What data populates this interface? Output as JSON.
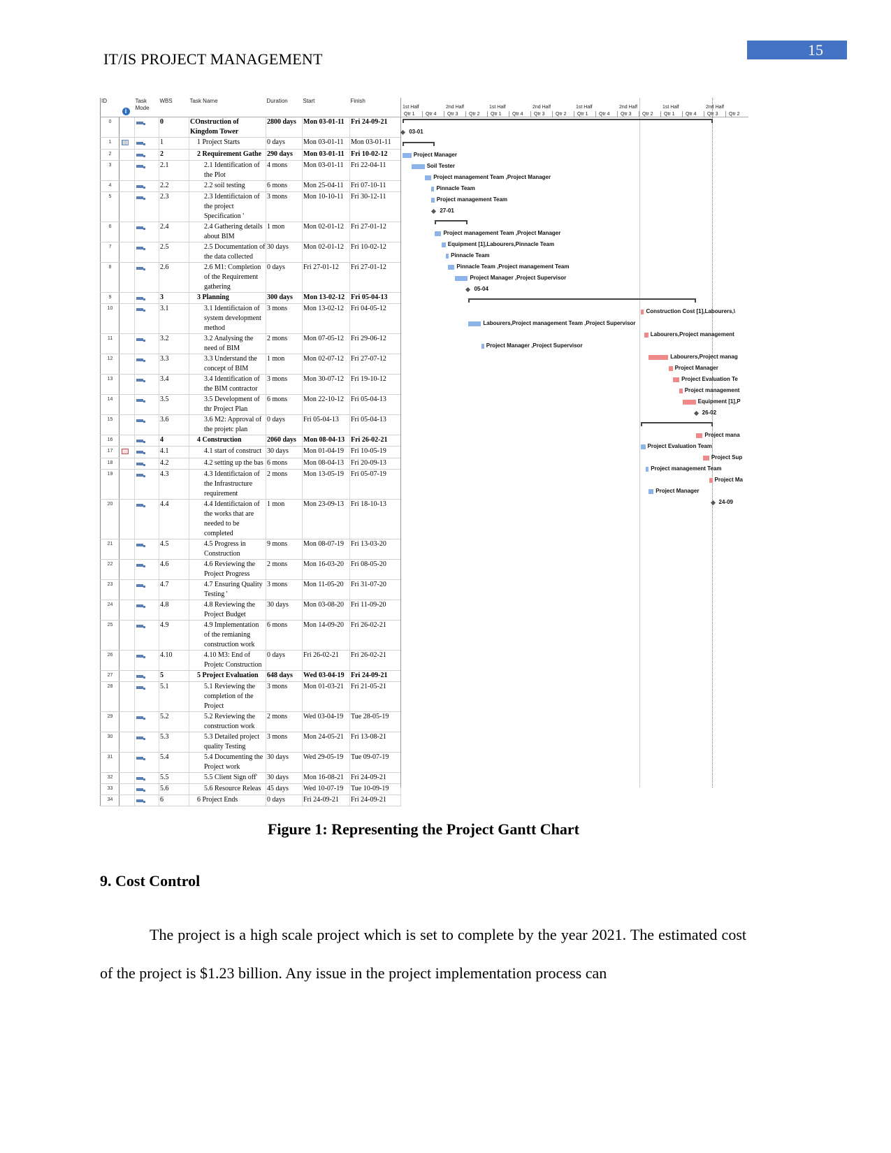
{
  "header": {
    "running_title": "IT/IS PROJECT MANAGEMENT",
    "page_number": "15",
    "page_number_bg": "#4472c4"
  },
  "gantt": {
    "columns": {
      "id": "ID",
      "task_mode": "Task Mode",
      "wbs": "WBS",
      "task_name": "Task Name",
      "duration": "Duration",
      "start": "Start",
      "finish": "Finish"
    },
    "timescale": {
      "top": [
        "1st Half",
        "2nd Half",
        "1st Half",
        "2nd Half",
        "1st Half",
        "2nd Half",
        "1st Half",
        "2nd Half"
      ],
      "bottom": [
        "Qtr 1",
        "Qtr 4",
        "Qtr 3",
        "Qtr 2",
        "Qtr 1",
        "Qtr 4",
        "Qtr 3",
        "Qtr 2",
        "Qtr 1",
        "Qtr 4",
        "Qtr 3",
        "Qtr 2",
        "Qtr 1",
        "Qtr 4",
        "Qtr 3",
        "Qtr 2"
      ]
    },
    "colors": {
      "normal_bar": "#8db4e8",
      "critical_bar": "#f08a8a",
      "summary": "#444444",
      "milestone": "#555555"
    },
    "tasks": [
      {
        "id": "0",
        "wbs": "0",
        "name": "COnstruction of Kingdom Tower",
        "duration": "2800 days",
        "start": "Mon 03-01-11",
        "finish": "Fri 24-09-21",
        "summary": true,
        "resources": ""
      },
      {
        "id": "1",
        "wbs": "1",
        "name": "1 Project Starts",
        "duration": "0 days",
        "start": "Mon 03-01-11",
        "finish": "Mon 03-01-11",
        "milestone": true,
        "resources": "03-01",
        "indicator": "calendar"
      },
      {
        "id": "2",
        "wbs": "2",
        "name": "2 Requirement Gathe",
        "duration": "290 days",
        "start": "Mon 03-01-11",
        "finish": "Fri 10-02-12",
        "summary": true,
        "resources": ""
      },
      {
        "id": "3",
        "wbs": "2.1",
        "name": "2.1 Identification of the Plot",
        "duration": "4 mons",
        "start": "Mon 03-01-11",
        "finish": "Fri 22-04-11",
        "resources": "Project Manager"
      },
      {
        "id": "4",
        "wbs": "2.2",
        "name": "2.2 soil testing",
        "duration": "6 mons",
        "start": "Mon 25-04-11",
        "finish": "Fri 07-10-11",
        "resources": "Soil Tester"
      },
      {
        "id": "5",
        "wbs": "2.3",
        "name": "2.3 Identifictaion of the project Specification '",
        "duration": "3 mons",
        "start": "Mon 10-10-11",
        "finish": "Fri 30-12-11",
        "resources": "Project management Team ,Project Manager"
      },
      {
        "id": "6",
        "wbs": "2.4",
        "name": "2.4 Gathering details about BIM",
        "duration": "1 mon",
        "start": "Mon 02-01-12",
        "finish": "Fri 27-01-12",
        "resources": "Pinnacle Team"
      },
      {
        "id": "7",
        "wbs": "2.5",
        "name": "2.5 Documentation of the data collected",
        "duration": "30 days",
        "start": "Mon 02-01-12",
        "finish": "Fri 10-02-12",
        "resources": "Project management Team"
      },
      {
        "id": "8",
        "wbs": "2.6",
        "name": "2.6 M1: Completion of the Requirement gathering",
        "duration": "0 days",
        "start": "Fri 27-01-12",
        "finish": "Fri 27-01-12",
        "milestone": true,
        "resources": "27-01"
      },
      {
        "id": "9",
        "wbs": "3",
        "name": "3 Planning",
        "duration": "300 days",
        "start": "Mon 13-02-12",
        "finish": "Fri 05-04-13",
        "summary": true,
        "resources": ""
      },
      {
        "id": "10",
        "wbs": "3.1",
        "name": "3.1 Identifictaion of system development method",
        "duration": "3 mons",
        "start": "Mon 13-02-12",
        "finish": "Fri 04-05-12",
        "resources": "Project management Team ,Project Manager"
      },
      {
        "id": "11",
        "wbs": "3.2",
        "name": "3.2 Analysing the need of BIM",
        "duration": "2 mons",
        "start": "Mon 07-05-12",
        "finish": "Fri 29-06-12",
        "resources": "Equipment [1],Labourers,Pinnacle Team"
      },
      {
        "id": "12",
        "wbs": "3.3",
        "name": "3.3 Understand the concept of BIM",
        "duration": "1 mon",
        "start": "Mon 02-07-12",
        "finish": "Fri 27-07-12",
        "resources": "Pinnacle Team"
      },
      {
        "id": "13",
        "wbs": "3.4",
        "name": "3.4 Identification of the BIM contractor",
        "duration": "3 mons",
        "start": "Mon 30-07-12",
        "finish": "Fri 19-10-12",
        "resources": "Pinnacle Team ,Project management Team"
      },
      {
        "id": "14",
        "wbs": "3.5",
        "name": "3.5 Development of thr Project Plan",
        "duration": "6 mons",
        "start": "Mon 22-10-12",
        "finish": "Fri 05-04-13",
        "resources": "Project Manager ,Project Supervisor"
      },
      {
        "id": "15",
        "wbs": "3.6",
        "name": "3.6 M2: Approval of the projetc plan",
        "duration": "0 days",
        "start": "Fri 05-04-13",
        "finish": "Fri 05-04-13",
        "milestone": true,
        "resources": "05-04"
      },
      {
        "id": "16",
        "wbs": "4",
        "name": "4 Construction",
        "duration": "2060 days",
        "start": "Mon 08-04-13",
        "finish": "Fri 26-02-21",
        "summary": true,
        "resources": ""
      },
      {
        "id": "17",
        "wbs": "4.1",
        "name": "4.1 start of construct",
        "duration": "30 days",
        "start": "Mon 01-04-19",
        "finish": "Fri 10-05-19",
        "critical": true,
        "resources": "Construction Cost [1],Labourers,\\",
        "indicator": "flag"
      },
      {
        "id": "18",
        "wbs": "4.2",
        "name": "4.2 setting up the bas",
        "duration": "6 mons",
        "start": "Mon 08-04-13",
        "finish": "Fri 20-09-13",
        "resources": "Labourers,Project management Team ,Project Supervisor"
      },
      {
        "id": "19",
        "wbs": "4.3",
        "name": "4.3 Identifictaion of the Infrastructure requirement",
        "duration": "2 mons",
        "start": "Mon 13-05-19",
        "finish": "Fri 05-07-19",
        "critical": true,
        "resources": "Labourers,Project management"
      },
      {
        "id": "20",
        "wbs": "4.4",
        "name": "4.4 Identifictaion of the works that are needed to be completed",
        "duration": "1 mon",
        "start": "Mon 23-09-13",
        "finish": "Fri 18-10-13",
        "resources": "Project Manager ,Project Supervisor"
      },
      {
        "id": "21",
        "wbs": "4.5",
        "name": "4.5 Progress in Construction",
        "duration": "9 mons",
        "start": "Mon 08-07-19",
        "finish": "Fri 13-03-20",
        "critical": true,
        "resources": "Labourers,Project manag"
      },
      {
        "id": "22",
        "wbs": "4.6",
        "name": "4.6 Reviewing the Project Progress",
        "duration": "2 mons",
        "start": "Mon 16-03-20",
        "finish": "Fri 08-05-20",
        "critical": true,
        "resources": "Project Manager"
      },
      {
        "id": "23",
        "wbs": "4.7",
        "name": "4.7 Ensuring Quality Testing '",
        "duration": "3 mons",
        "start": "Mon 11-05-20",
        "finish": "Fri 31-07-20",
        "critical": true,
        "resources": "Project Evaluation Te"
      },
      {
        "id": "24",
        "wbs": "4.8",
        "name": "4.8 Reviewing the Project Budget",
        "duration": "30 days",
        "start": "Mon 03-08-20",
        "finish": "Fri 11-09-20",
        "critical": true,
        "resources": "Project management"
      },
      {
        "id": "25",
        "wbs": "4.9",
        "name": "4.9 Implementation of the remianing construction work",
        "duration": "6 mons",
        "start": "Mon 14-09-20",
        "finish": "Fri 26-02-21",
        "critical": true,
        "resources": "Equipment [1],P"
      },
      {
        "id": "26",
        "wbs": "4.10",
        "name": "4.10 M3: End of Projetc Construction",
        "duration": "0 days",
        "start": "Fri 26-02-21",
        "finish": "Fri 26-02-21",
        "milestone": true,
        "resources": "26-02"
      },
      {
        "id": "27",
        "wbs": "5",
        "name": "5 Project Evaluation",
        "duration": "648 days",
        "start": "Wed 03-04-19",
        "finish": "Fri 24-09-21",
        "summary": true,
        "resources": ""
      },
      {
        "id": "28",
        "wbs": "5.1",
        "name": "5.1 Reviewing the completion of the Project",
        "duration": "3 mons",
        "start": "Mon 01-03-21",
        "finish": "Fri 21-05-21",
        "critical": true,
        "resources": "Project mana"
      },
      {
        "id": "29",
        "wbs": "5.2",
        "name": "5.2 Reviewing the construction work",
        "duration": "2 mons",
        "start": "Wed 03-04-19",
        "finish": "Tue 28-05-19",
        "resources": "Project Evaluation Team"
      },
      {
        "id": "30",
        "wbs": "5.3",
        "name": "5.3 Detailed project quality Testing",
        "duration": "3 mons",
        "start": "Mon 24-05-21",
        "finish": "Fri 13-08-21",
        "critical": true,
        "resources": "Project Sup"
      },
      {
        "id": "31",
        "wbs": "5.4",
        "name": "5.4 Documenting the Project work",
        "duration": "30 days",
        "start": "Wed 29-05-19",
        "finish": "Tue 09-07-19",
        "resources": "Project management Team"
      },
      {
        "id": "32",
        "wbs": "5.5",
        "name": "5.5 Client Sign off'",
        "duration": "30 days",
        "start": "Mon 16-08-21",
        "finish": "Fri 24-09-21",
        "critical": true,
        "resources": "Project Ma"
      },
      {
        "id": "33",
        "wbs": "5.6",
        "name": "5.6 Resource Releas",
        "duration": "45 days",
        "start": "Wed 10-07-19",
        "finish": "Tue 10-09-19",
        "resources": "Project Manager"
      },
      {
        "id": "34",
        "wbs": "6",
        "name": "6 Project Ends",
        "duration": "0 days",
        "start": "Fri 24-09-21",
        "finish": "Fri 24-09-21",
        "milestone": true,
        "resources": "24-09"
      }
    ]
  },
  "caption": "Figure 1: Representing the Project Gantt Chart",
  "section_heading": "9. Cost Control",
  "paragraph": "The project is a high scale project which is set to complete by the year 2021. The estimated cost of the project is $1.23 billion. Any issue in the project implementation process can"
}
